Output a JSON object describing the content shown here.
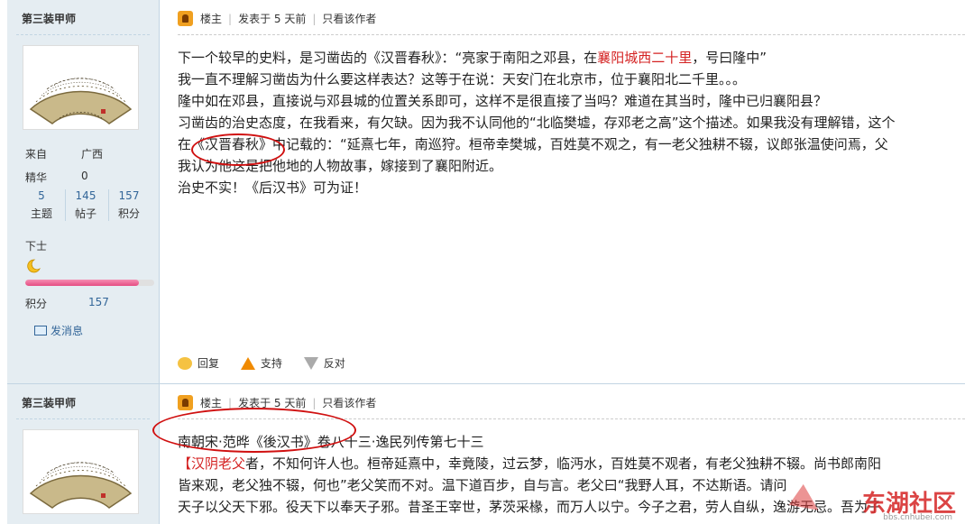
{
  "posts": [
    {
      "user": {
        "name": "第三装甲师",
        "from_label": "来自",
        "from_value": "广西",
        "essence_label": "精华",
        "essence_value": "0",
        "stats": [
          {
            "n": "5",
            "l": "主题"
          },
          {
            "n": "145",
            "l": "帖子"
          },
          {
            "n": "157",
            "l": "积分"
          }
        ],
        "rank": "下士",
        "points_label": "积分",
        "points_value": "157",
        "message": "发消息"
      },
      "meta": {
        "role": "楼主",
        "posted": "发表于 5 天前",
        "author_only": "只看该作者"
      },
      "lines": [
        {
          "a": "下一个较早的史料，是习凿齿的《汉晋春秋》：“亮家于南阳之邓县，在",
          "r": "襄阳城西二十里",
          "b": "，号曰隆中”"
        },
        {
          "a": "我一直不理解习凿齿为什么要这样表达？这等于在说：天安门在北京市，位于襄阳北二千里。。。"
        },
        {
          "a": "隆中如在邓县，直接说与邓县城的位置关系即可，这样不是很直接了当吗？难道在其当时，隆中已归襄阳县？"
        },
        {
          "a": "习凿齿的治史态度，在我看来，有欠缺。因为我不认同他的“北临樊墟，存邓老之高”这个描述。如果我没有理解错，这个"
        },
        {
          "a": "在《汉晋春秋》中记载的：“延熹七年，南巡狩。桓帝幸樊城，百姓莫不观之，有一老父独耕不辍，议郎张温使问焉，父"
        },
        {
          "a": "我认为他这是把他地的人物故事，嫁接到了襄阳附近。"
        },
        {
          "a": "治史不实！《后汉书》可为证！"
        }
      ],
      "actions": {
        "reply": "回复",
        "support": "支持",
        "oppose": "反对"
      }
    },
    {
      "user": {
        "name": "第三装甲师"
      },
      "meta": {
        "role": "楼主",
        "posted": "发表于 5 天前",
        "author_only": "只看该作者"
      },
      "lines": [
        {
          "a": "南朝宋·范晔《後汉书》卷八十三·逸民列传第七十三"
        },
        {
          "r": "【汉阴老父",
          "a": "者，不知何许人也。桓帝延熹中，幸竟陵，过云梦，临沔水，百姓莫不观者，有老父独耕不辍。尚书郎南阳"
        },
        {
          "a": "皆来观，老父独不辍，何也”老父笑而不对。温下道百步，自与言。老父曰“我野人耳，不达斯语。请问"
        },
        {
          "a": "天子以父天下邪。役天下以奉天子邪。昔圣王宰世，茅茨采椽，而万人以宁。今子之君，劳人自纵，逸游无忌。吾为子"
        }
      ]
    }
  ],
  "watermark": {
    "text": "东湖社区",
    "sub": "bbs.cnhubei.com"
  }
}
